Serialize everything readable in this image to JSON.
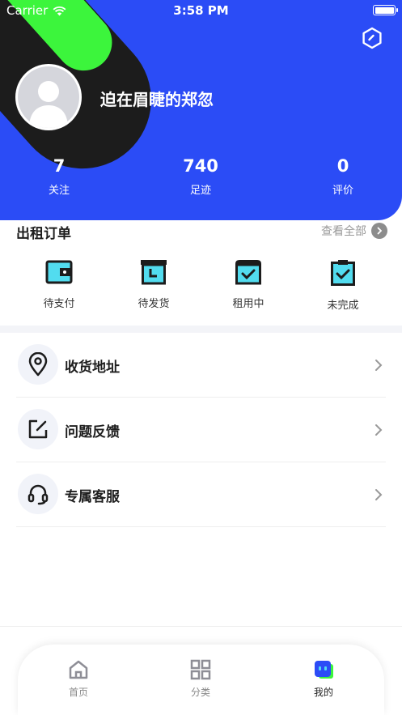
{
  "status_bar": {
    "carrier": "Carrier",
    "time": "3:58 PM"
  },
  "profile": {
    "username": "迫在眉睫的郑忽"
  },
  "stats": [
    {
      "value": "7",
      "label": "关注"
    },
    {
      "value": "740",
      "label": "足迹"
    },
    {
      "value": "0",
      "label": "评价"
    }
  ],
  "orders": {
    "title": "出租订单",
    "view_all": "查看全部",
    "items": [
      {
        "label": "待支付",
        "icon": "wallet-icon"
      },
      {
        "label": "待发货",
        "icon": "box-clock-icon"
      },
      {
        "label": "租用中",
        "icon": "box-check-icon"
      },
      {
        "label": "未完成",
        "icon": "clipboard-check-icon"
      }
    ]
  },
  "menu": [
    {
      "label": "收货地址",
      "icon": "location-pin-icon"
    },
    {
      "label": "问题反馈",
      "icon": "edit-icon"
    },
    {
      "label": "专属客服",
      "icon": "headset-icon"
    }
  ],
  "tabbar": [
    {
      "label": "首页",
      "icon": "home-icon"
    },
    {
      "label": "分类",
      "icon": "grid-icon"
    },
    {
      "label": "我的",
      "icon": "profile-icon",
      "active": true
    }
  ],
  "colors": {
    "header": "#2b4cf6",
    "accent_green": "#3cf53c",
    "accent_cyan": "#52dcef",
    "dark": "#1c1c1c"
  }
}
